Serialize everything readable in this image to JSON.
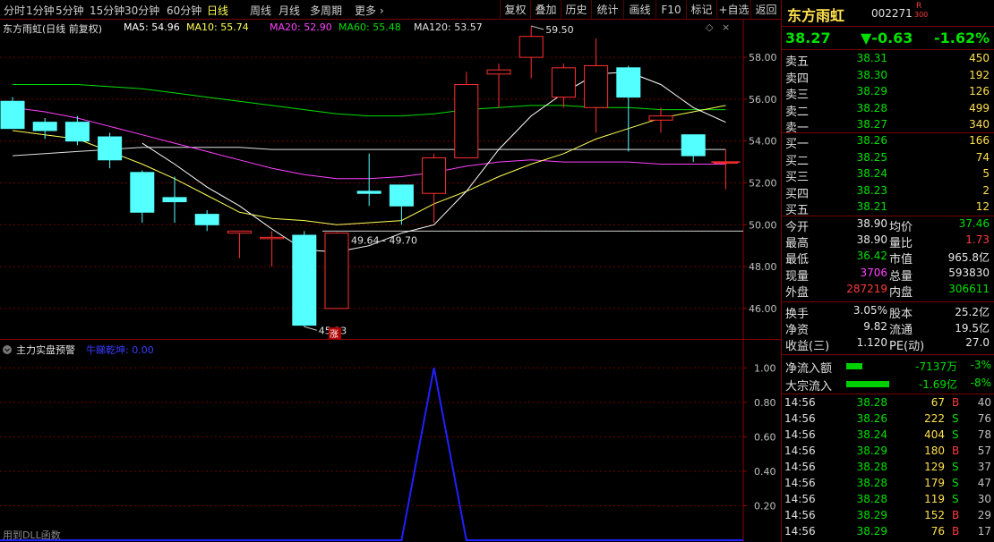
{
  "toolbar": {
    "periods": [
      "分时",
      "1分钟",
      "5分钟",
      "15分钟",
      "30分钟",
      "60分钟",
      "日线",
      "周线",
      "月线",
      "多周期",
      "更多"
    ],
    "active_period": "日线",
    "buttons": [
      "复权",
      "叠加",
      "历史",
      "统计",
      "画线",
      "F10",
      "标记",
      "+自选",
      "返回"
    ]
  },
  "legend": {
    "title": "东方雨虹(日线 前复权)",
    "ma5": "MA5: 54.96",
    "ma10": "MA10: 55.74",
    "ma20": "MA20: 52.90",
    "ma60": "MA60: 55.48",
    "ma120": "MA120: 53.57",
    "colors": {
      "ma5": "#ffffff",
      "ma10": "#ffff55",
      "ma20": "#ff40ff",
      "ma60": "#00e000",
      "ma120": "#e0e0e0"
    }
  },
  "chart_data": {
    "type": "candlestick",
    "ylim": [
      44.5,
      59.8
    ],
    "y_ticks": [
      "58.00",
      "56.00",
      "54.00",
      "52.00",
      "50.00",
      "48.00",
      "46.00"
    ],
    "candles": [
      {
        "o": 55.9,
        "h": 56.1,
        "l": 54.6,
        "c": 54.6
      },
      {
        "o": 54.9,
        "h": 55.1,
        "l": 54.1,
        "c": 54.5
      },
      {
        "o": 54.9,
        "h": 55.2,
        "l": 53.8,
        "c": 54.0
      },
      {
        "o": 54.2,
        "h": 54.4,
        "l": 52.7,
        "c": 53.1
      },
      {
        "o": 52.5,
        "h": 52.6,
        "l": 50.1,
        "c": 50.6
      },
      {
        "o": 51.3,
        "h": 52.3,
        "l": 50.1,
        "c": 51.1
      },
      {
        "o": 50.5,
        "h": 50.7,
        "l": 49.7,
        "c": 50.0
      },
      {
        "o": 49.6,
        "h": 49.7,
        "l": 48.4,
        "c": 49.7
      },
      {
        "o": 49.4,
        "h": 49.7,
        "l": 48.0,
        "c": 49.4
      },
      {
        "o": 49.5,
        "h": 49.7,
        "l": 45.13,
        "c": 45.2
      },
      {
        "o": 46.0,
        "h": 49.64,
        "l": 46.0,
        "c": 49.6
      },
      {
        "o": 51.6,
        "h": 53.4,
        "l": 50.9,
        "c": 51.5
      },
      {
        "o": 51.9,
        "h": 51.9,
        "l": 50.0,
        "c": 50.9
      },
      {
        "o": 51.5,
        "h": 53.4,
        "l": 50.1,
        "c": 53.2
      },
      {
        "o": 53.2,
        "h": 57.3,
        "l": 53.2,
        "c": 56.7
      },
      {
        "o": 57.2,
        "h": 57.7,
        "l": 55.6,
        "c": 57.4
      },
      {
        "o": 58.0,
        "h": 59.5,
        "l": 57.0,
        "c": 59.0
      },
      {
        "o": 56.1,
        "h": 57.7,
        "l": 55.6,
        "c": 57.5
      },
      {
        "o": 55.6,
        "h": 58.9,
        "l": 54.4,
        "c": 57.6
      },
      {
        "o": 57.5,
        "h": 57.6,
        "l": 53.5,
        "c": 56.1
      },
      {
        "o": 55.0,
        "h": 55.6,
        "l": 54.4,
        "c": 55.2
      },
      {
        "o": 54.3,
        "h": 54.3,
        "l": 53.0,
        "c": 53.3
      },
      {
        "o": 53.0,
        "h": 53.6,
        "l": 51.7,
        "c": 53.0
      }
    ],
    "ma5": [
      null,
      null,
      null,
      null,
      53.9,
      52.9,
      51.8,
      50.9,
      49.8,
      48.8,
      48.7,
      49.0,
      49.6,
      50.0,
      51.6,
      53.6,
      55.2,
      56.3,
      57.2,
      57.3,
      56.7,
      55.6,
      54.9
    ],
    "ma10": [
      54.5,
      54.3,
      54.1,
      53.5,
      52.9,
      52.2,
      51.4,
      50.6,
      50.3,
      50.2,
      50.0,
      50.1,
      50.2,
      51.0,
      51.6,
      52.3,
      52.9,
      53.4,
      54.1,
      54.6,
      55.1,
      55.4,
      55.7
    ],
    "ma20": [
      55.6,
      55.4,
      55.1,
      54.7,
      54.3,
      53.9,
      53.5,
      53.1,
      52.7,
      52.4,
      52.2,
      52.2,
      52.3,
      52.5,
      52.8,
      53.0,
      53.1,
      53.0,
      53.0,
      53.0,
      52.9,
      52.9,
      52.9
    ],
    "ma60": [
      56.7,
      56.7,
      56.7,
      56.6,
      56.5,
      56.3,
      56.1,
      55.9,
      55.7,
      55.5,
      55.3,
      55.2,
      55.2,
      55.3,
      55.5,
      55.6,
      55.7,
      55.7,
      55.6,
      55.6,
      55.5,
      55.5,
      55.5
    ],
    "ma120": [
      53.3,
      53.4,
      53.5,
      53.6,
      53.7,
      53.7,
      53.7,
      53.7,
      53.6,
      53.6,
      53.6,
      53.6,
      53.6,
      53.6,
      53.6,
      53.6,
      53.6,
      53.6,
      53.6,
      53.6,
      53.6,
      53.6,
      53.6
    ],
    "hline": 49.7,
    "annotations": {
      "high": {
        "index": 16,
        "value": 59.5,
        "label": "59.50"
      },
      "low": {
        "index": 9,
        "value": 45.13,
        "label": "45.13"
      },
      "range": {
        "index": 10,
        "label": "49.64 - 49.70"
      },
      "limit_up_tag": {
        "index": 10,
        "label": "涨"
      }
    },
    "sub": {
      "title": "主力实盘预警",
      "series_label": "牛睇乾坤: 0.00",
      "ylim": [
        0,
        1.1
      ],
      "y_ticks": [
        "1.00",
        "0.80",
        "0.60",
        "0.40",
        "0.20"
      ],
      "values": [
        0,
        0,
        0,
        0,
        0,
        0,
        0,
        0,
        0,
        0,
        0,
        0,
        0,
        1.0,
        0,
        0,
        0,
        0,
        0,
        0,
        0,
        0,
        0
      ],
      "footer": "用到DLL函数"
    }
  },
  "stock": {
    "name": "东方雨虹",
    "code": "002271",
    "tag_top": "R",
    "tag_bottom": "300",
    "price": "38.27",
    "change": "▼-0.63",
    "pct": "-1.62%"
  },
  "orderbook": {
    "sells": [
      {
        "label": "卖五",
        "price": "38.31",
        "vol": "450"
      },
      {
        "label": "卖四",
        "price": "38.30",
        "vol": "192"
      },
      {
        "label": "卖三",
        "price": "38.29",
        "vol": "126"
      },
      {
        "label": "卖二",
        "price": "38.28",
        "vol": "499"
      },
      {
        "label": "卖一",
        "price": "38.27",
        "vol": "340"
      }
    ],
    "buys": [
      {
        "label": "买一",
        "price": "38.26",
        "vol": "166"
      },
      {
        "label": "买二",
        "price": "38.25",
        "vol": "74"
      },
      {
        "label": "买三",
        "price": "38.24",
        "vol": "5"
      },
      {
        "label": "买四",
        "price": "38.23",
        "vol": "2"
      },
      {
        "label": "买五",
        "price": "38.21",
        "vol": "12"
      }
    ]
  },
  "stats": [
    {
      "l1": "今开",
      "v1": "38.90",
      "c1": "white",
      "l2": "均价",
      "v2": "37.46",
      "c2": "green"
    },
    {
      "l1": "最高",
      "v1": "38.90",
      "c1": "white",
      "l2": "量比",
      "v2": "1.73",
      "c2": "red"
    },
    {
      "l1": "最低",
      "v1": "36.42",
      "c1": "green",
      "l2": "市值",
      "v2": "965.8亿",
      "c2": "white"
    },
    {
      "l1": "现量",
      "v1": "3706",
      "c1": "magenta",
      "l2": "总量",
      "v2": "593830",
      "c2": "white"
    },
    {
      "l1": "外盘",
      "v1": "287219",
      "c1": "red",
      "l2": "内盘",
      "v2": "306611",
      "c2": "green"
    }
  ],
  "fundamentals": [
    {
      "l1": "换手",
      "v1": "3.05%",
      "l2": "股本",
      "v2": "25.2亿"
    },
    {
      "l1": "净资",
      "v1": "9.82",
      "l2": "流通",
      "v2": "19.5亿"
    },
    {
      "l1": "收益(三)",
      "v1": "1.120",
      "l2": "PE(动)",
      "v2": "27.0"
    }
  ],
  "flows": [
    {
      "label": "净流入额",
      "value": "-7137万",
      "pct": "-3%",
      "bar": 0.3
    },
    {
      "label": "大宗流入",
      "value": "-1.69亿",
      "pct": "-8%",
      "bar": 0.8
    }
  ],
  "ticks": [
    {
      "time": "14:56",
      "price": "38.28",
      "vol": "67",
      "side": "B",
      "n": "40"
    },
    {
      "time": "14:56",
      "price": "38.26",
      "vol": "222",
      "side": "S",
      "n": "76"
    },
    {
      "time": "14:56",
      "price": "38.24",
      "vol": "404",
      "side": "S",
      "n": "78"
    },
    {
      "time": "14:56",
      "price": "38.29",
      "vol": "180",
      "side": "B",
      "n": "57"
    },
    {
      "time": "14:56",
      "price": "38.28",
      "vol": "129",
      "side": "S",
      "n": "37"
    },
    {
      "time": "14:56",
      "price": "38.28",
      "vol": "179",
      "side": "S",
      "n": "47"
    },
    {
      "time": "14:56",
      "price": "38.28",
      "vol": "119",
      "side": "S",
      "n": "30"
    },
    {
      "time": "14:56",
      "price": "38.29",
      "vol": "152",
      "side": "B",
      "n": "29"
    },
    {
      "time": "14:56",
      "price": "38.29",
      "vol": "76",
      "side": "B",
      "n": "17"
    }
  ]
}
